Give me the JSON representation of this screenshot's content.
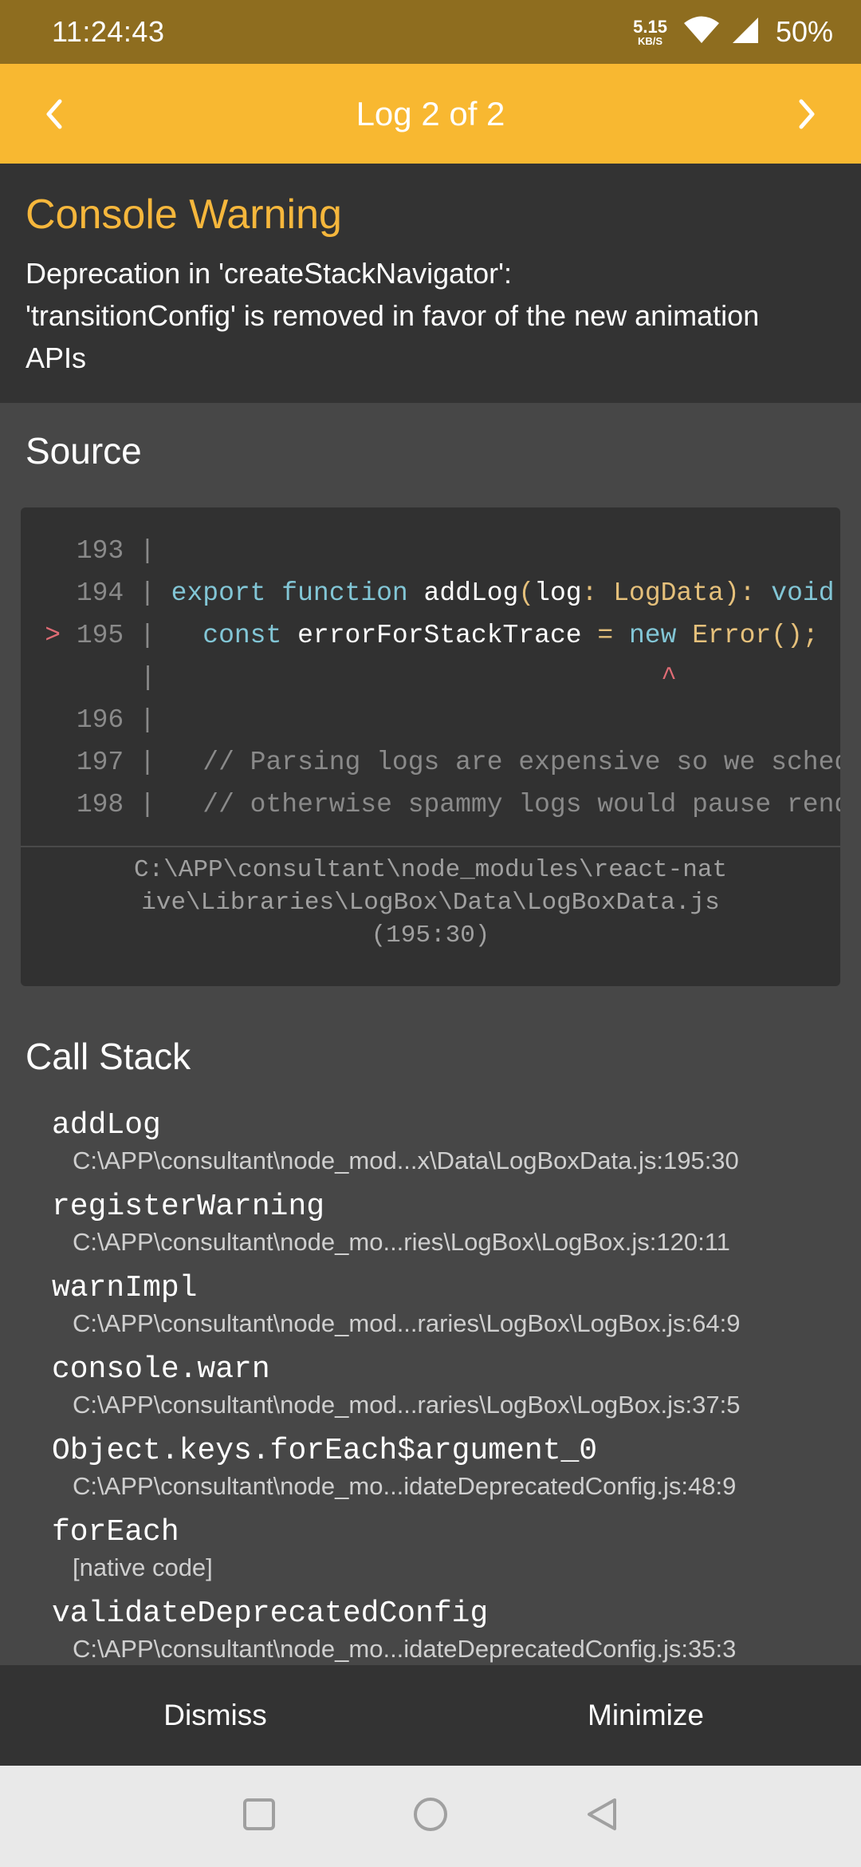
{
  "status_bar": {
    "time": "11:24:43",
    "net_speed_value": "5.15",
    "net_speed_unit": "KB/S",
    "battery": "50%"
  },
  "header": {
    "title": "Log 2 of 2",
    "prev_icon": "chevron-left-icon",
    "next_icon": "chevron-right-icon"
  },
  "warning": {
    "title": "Console Warning",
    "message_lines": [
      "Deprecation in 'createStackNavigator':",
      "'transitionConfig' is removed in favor of the new animation",
      "APIs"
    ]
  },
  "source": {
    "title": "Source",
    "lines": [
      {
        "marker": "",
        "num": "193",
        "code": ""
      },
      {
        "marker": "",
        "num": "194",
        "code": "export function addLog(log: LogData): void {"
      },
      {
        "marker": ">",
        "num": "195",
        "code": "  const errorForStackTrace = new Error();"
      },
      {
        "marker": "",
        "num": "",
        "code": "                               ^"
      },
      {
        "marker": "",
        "num": "196",
        "code": ""
      },
      {
        "marker": "",
        "num": "197",
        "code": "  // Parsing logs are expensive so we schedule"
      },
      {
        "marker": "",
        "num": "198",
        "code": "  // otherwise spammy logs would pause rendering"
      }
    ],
    "path_lines": [
      "C:\\APP\\consultant\\node_modules\\react-nat",
      "ive\\Libraries\\LogBox\\Data\\LogBoxData.js",
      "(195:30)"
    ]
  },
  "call_stack": {
    "title": "Call Stack",
    "frames": [
      {
        "fn": "addLog",
        "loc": "C:\\APP\\consultant\\node_mod...x\\Data\\LogBoxData.js:195:30"
      },
      {
        "fn": "registerWarning",
        "loc": "C:\\APP\\consultant\\node_mo...ries\\LogBox\\LogBox.js:120:11"
      },
      {
        "fn": "warnImpl",
        "loc": "C:\\APP\\consultant\\node_mod...raries\\LogBox\\LogBox.js:64:9"
      },
      {
        "fn": "console.warn",
        "loc": "C:\\APP\\consultant\\node_mod...raries\\LogBox\\LogBox.js:37:5"
      },
      {
        "fn": "Object.keys.forEach$argument_0",
        "loc": "C:\\APP\\consultant\\node_mo...idateDeprecatedConfig.js:48:9"
      },
      {
        "fn": "forEach",
        "loc": "[native code]"
      },
      {
        "fn": "validateDeprecatedConfig",
        "loc": "C:\\APP\\consultant\\node_mo...idateDeprecatedConfig.js:35:3"
      }
    ]
  },
  "actions": {
    "dismiss": "Dismiss",
    "minimize": "Minimize"
  },
  "colors": {
    "accent": "#f8b831",
    "status_bar": "#8e6d1f",
    "warning_title": "#f6b73c",
    "background": "#474747"
  }
}
